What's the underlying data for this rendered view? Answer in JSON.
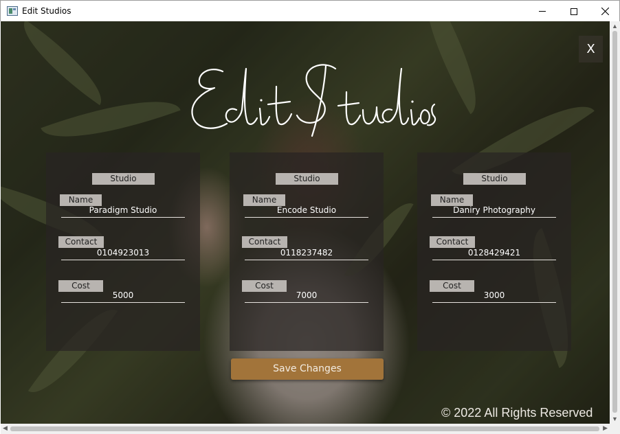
{
  "window": {
    "title": "Edit Studios",
    "close_label": "X"
  },
  "header": {
    "logo_text": "Edit Studios"
  },
  "cards": [
    {
      "heading": "Studio",
      "name_label": "Name",
      "name_value": "Paradigm Studio",
      "contact_label": "Contact",
      "contact_value": "0104923013",
      "cost_label": "Cost",
      "cost_value": "5000"
    },
    {
      "heading": "Studio",
      "name_label": "Name",
      "name_value": "Encode Studio",
      "contact_label": "Contact",
      "contact_value": "0118237482",
      "cost_label": "Cost",
      "cost_value": "7000"
    },
    {
      "heading": "Studio",
      "name_label": "Name",
      "name_value": "Daniry Photography",
      "contact_label": "Contact",
      "contact_value": "0128429421",
      "cost_label": "Cost",
      "cost_value": "3000"
    }
  ],
  "actions": {
    "save_label": "Save Changes"
  },
  "footer": {
    "copyright": "© 2022 All Rights Reserved"
  },
  "colors": {
    "save_button": "#a2743a",
    "card_background": "#282422",
    "label_background": "#b8b4b0"
  },
  "icons": {
    "minimize": "minimize-icon",
    "maximize": "maximize-icon",
    "close": "close-icon",
    "app": "app-icon"
  }
}
